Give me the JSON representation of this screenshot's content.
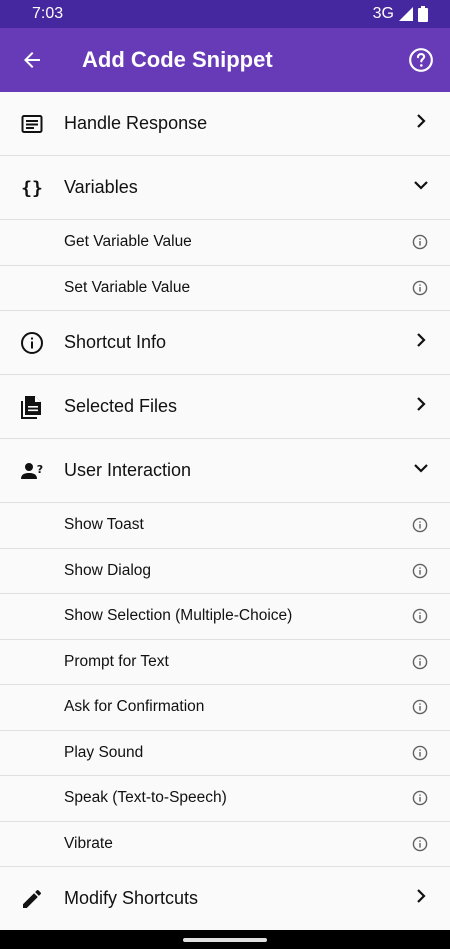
{
  "status": {
    "time": "7:03",
    "network": "3G"
  },
  "appbar": {
    "title": "Add Code Snippet",
    "back_icon": "arrow-left-icon",
    "help_icon": "help-circle-icon"
  },
  "rows": [
    {
      "kind": "cat",
      "label": "Handle Response",
      "icon": "message-box-icon",
      "chevron": "right"
    },
    {
      "kind": "cat",
      "label": "Variables",
      "icon": "braces-icon",
      "chevron": "down"
    },
    {
      "kind": "sub",
      "label": "Get Variable Value"
    },
    {
      "kind": "sub",
      "label": "Set Variable Value"
    },
    {
      "kind": "cat",
      "label": "Shortcut Info",
      "icon": "info-circle-icon",
      "chevron": "right"
    },
    {
      "kind": "cat",
      "label": "Selected Files",
      "icon": "files-icon",
      "chevron": "right"
    },
    {
      "kind": "cat",
      "label": "User Interaction",
      "icon": "user-question-icon",
      "chevron": "down"
    },
    {
      "kind": "sub",
      "label": "Show Toast"
    },
    {
      "kind": "sub",
      "label": "Show Dialog"
    },
    {
      "kind": "sub",
      "label": "Show Selection (Multiple-Choice)"
    },
    {
      "kind": "sub",
      "label": "Prompt for Text"
    },
    {
      "kind": "sub",
      "label": "Ask for Confirmation"
    },
    {
      "kind": "sub",
      "label": "Play Sound"
    },
    {
      "kind": "sub",
      "label": "Speak (Text-to-Speech)"
    },
    {
      "kind": "sub",
      "label": "Vibrate"
    },
    {
      "kind": "cat",
      "label": "Modify Shortcuts",
      "icon": "pencil-icon",
      "chevron": "right"
    }
  ],
  "colors": {
    "statusbar": "#4527a0",
    "appbar": "#673ab7",
    "background": "#fafafa",
    "divider": "#e0e0e0"
  }
}
